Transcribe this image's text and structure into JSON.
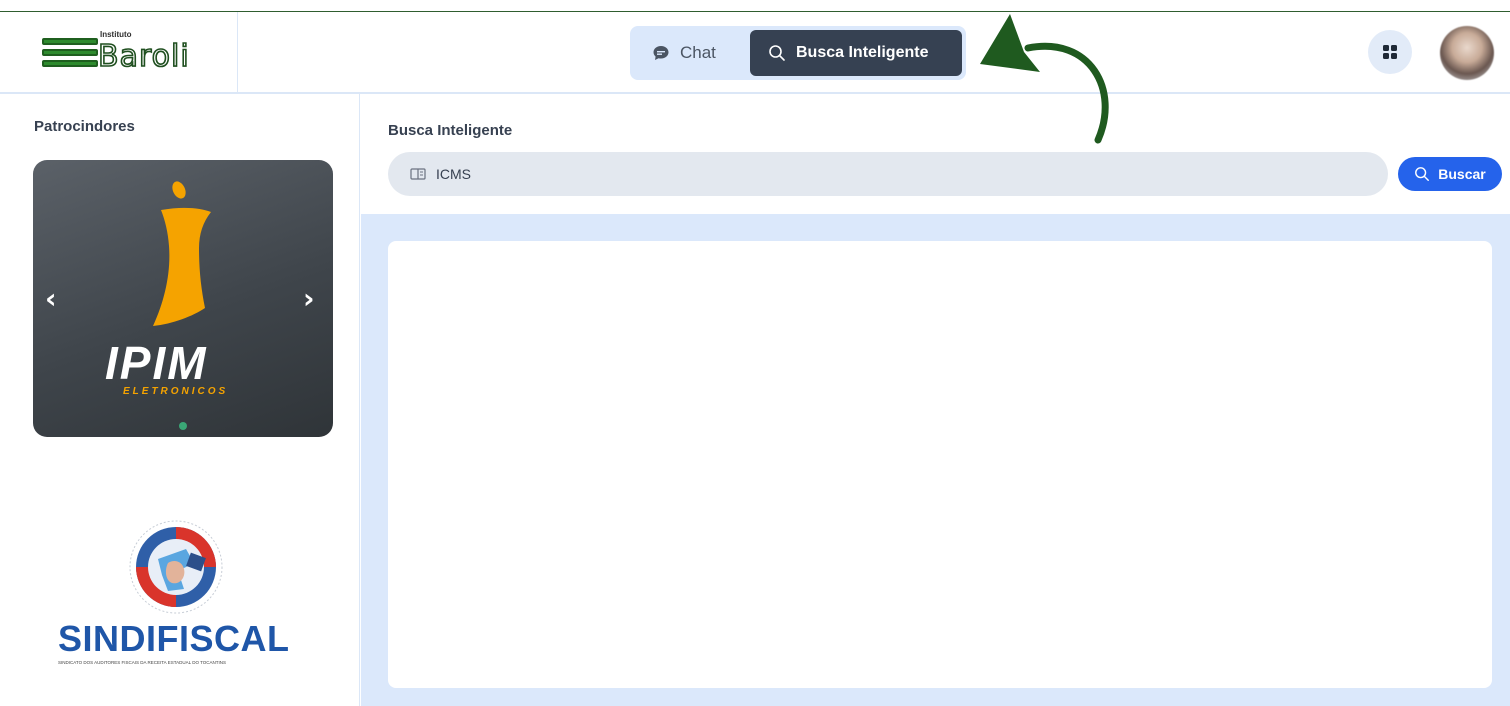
{
  "header": {
    "logo_small": "Instituto",
    "logo_text": "Baroli",
    "tabs": [
      {
        "label": "Chat",
        "icon": "chat-bubble-icon",
        "active": false
      },
      {
        "label": "Busca Inteligente",
        "icon": "search-icon",
        "active": true
      }
    ],
    "apps_icon": "grid-icon"
  },
  "sidebar": {
    "title": "Patrocindores",
    "carousel": {
      "brand": "IPIM",
      "tagline": "ELETRONICOS",
      "accent": "#f5a300",
      "prev_icon": "chevron-left-icon",
      "next_icon": "chevron-right-icon"
    },
    "sponsor2": {
      "name": "SINDIFISCAL",
      "subtitle": "SINDICATO DOS AUDITORES FISCAIS DA RECEITA ESTADUAL DO TOCANTINS"
    }
  },
  "main": {
    "search_title": "Busca Inteligente",
    "search_value": "ICMS",
    "search_button": "Buscar",
    "accent": "#2563eb"
  }
}
